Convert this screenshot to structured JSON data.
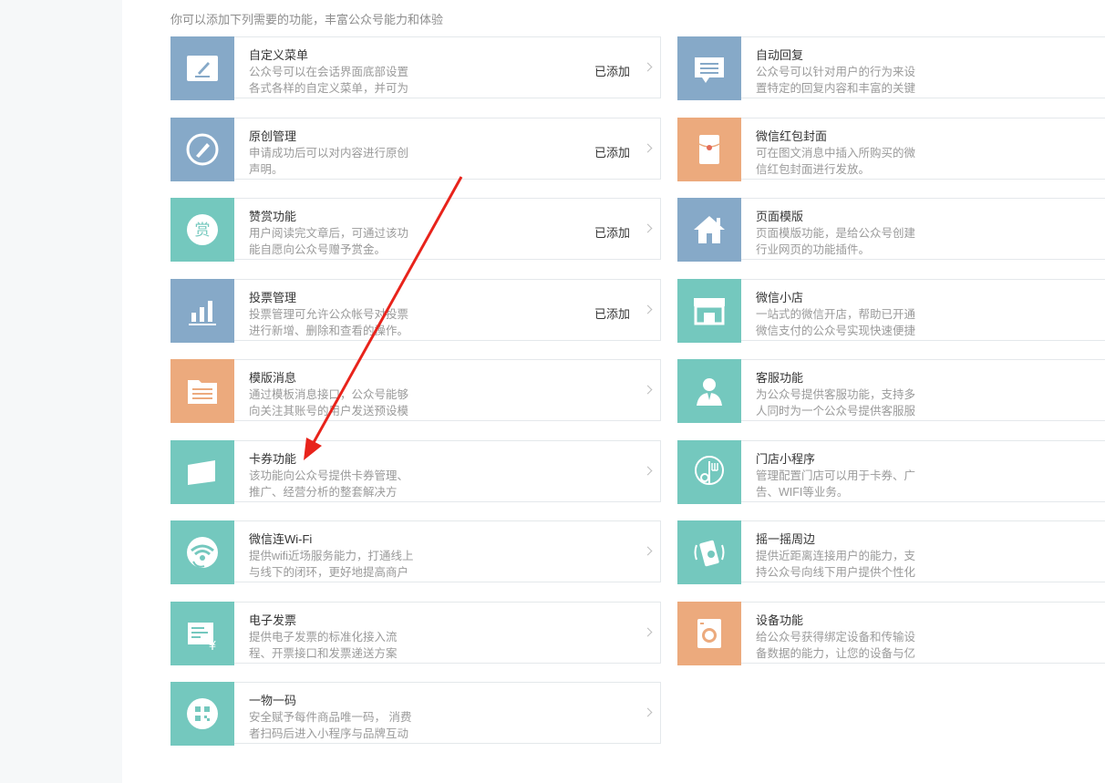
{
  "intro": "你可以添加下列需要的功能，丰富公众号能力和体验",
  "added_label": "已添加",
  "left_cards": [
    {
      "title": "自定义菜单",
      "line1": "公众号可以在会话界面底部设置",
      "line2": "各式各样的自定义菜单，并可为",
      "status": "已添加",
      "icon": "pencil-icon",
      "color": "blue"
    },
    {
      "title": "原创管理",
      "line1": "申请成功后可以对内容进行原创",
      "line2": "声明。",
      "status": "已添加",
      "icon": "circle-pencil-icon",
      "color": "blue"
    },
    {
      "title": "赞赏功能",
      "line1": "用户阅读完文章后，可通过该功",
      "line2": "能自愿向公众号赠予赏金。",
      "status": "已添加",
      "icon": "reward-icon",
      "color": "teal"
    },
    {
      "title": "投票管理",
      "line1": "投票管理可允许公众帐号对投票",
      "line2": "进行新增、删除和查看的操作。",
      "status": "已添加",
      "icon": "bar-chart-icon",
      "color": "blue"
    },
    {
      "title": "模版消息",
      "line1": "通过模板消息接口，公众号能够",
      "line2": "向关注其账号的用户发送预设模",
      "status": "",
      "icon": "folder-doc-icon",
      "color": "orange"
    },
    {
      "title": "卡券功能",
      "line1": "该功能向公众号提供卡券管理、",
      "line2": "推广、经营分析的整套解决方",
      "status": "",
      "icon": "card-icon",
      "color": "teal"
    },
    {
      "title": "微信连Wi-Fi",
      "line1": "提供wifi近场服务能力，打通线上",
      "line2": "与线下的闭环，更好地提高商户",
      "status": "",
      "icon": "wifi-icon",
      "color": "teal"
    },
    {
      "title": "电子发票",
      "line1": "提供电子发票的标准化接入流",
      "line2": "程、开票接口和发票递送方案",
      "status": "",
      "icon": "invoice-icon",
      "color": "teal"
    },
    {
      "title": "一物一码",
      "line1": "安全赋予每件商品唯一码， 消费",
      "line2": "者扫码后进入小程序与品牌互动",
      "status": "",
      "icon": "qr-code-icon",
      "color": "teal"
    }
  ],
  "right_cards": [
    {
      "title": "自动回复",
      "line1": "公众号可以针对用户的行为来设",
      "line2": "置特定的回复内容和丰富的关键",
      "icon": "message-icon",
      "color": "blue"
    },
    {
      "title": "微信红包封面",
      "line1": "可在图文消息中插入所购买的微",
      "line2": "信红包封面进行发放。",
      "icon": "red-packet-icon",
      "color": "orange"
    },
    {
      "title": "页面模版",
      "line1": "页面模版功能，是给公众号创建",
      "line2": "行业网页的功能插件。",
      "icon": "house-icon",
      "color": "blue"
    },
    {
      "title": "微信小店",
      "line1": "一站式的微信开店，帮助已开通",
      "line2": "微信支付的公众号实现快速便捷",
      "icon": "shop-icon",
      "color": "teal"
    },
    {
      "title": "客服功能",
      "line1": "为公众号提供客服功能，支持多",
      "line2": "人同时为一个公众号提供客服服",
      "icon": "customer-service-icon",
      "color": "teal"
    },
    {
      "title": "门店小程序",
      "line1": "管理配置门店可以用于卡券、广",
      "line2": "告、WIFI等业务。",
      "icon": "store-pin-icon",
      "color": "teal"
    },
    {
      "title": "摇一摇周边",
      "line1": "提供近距离连接用户的能力，支",
      "line2": "持公众号向线下用户提供个性化",
      "icon": "shake-phone-icon",
      "color": "teal"
    },
    {
      "title": "设备功能",
      "line1": "给公众号获得绑定设备和传输设",
      "line2": "备数据的能力，让您的设备与亿",
      "icon": "washing-machine-icon",
      "color": "orange"
    }
  ]
}
